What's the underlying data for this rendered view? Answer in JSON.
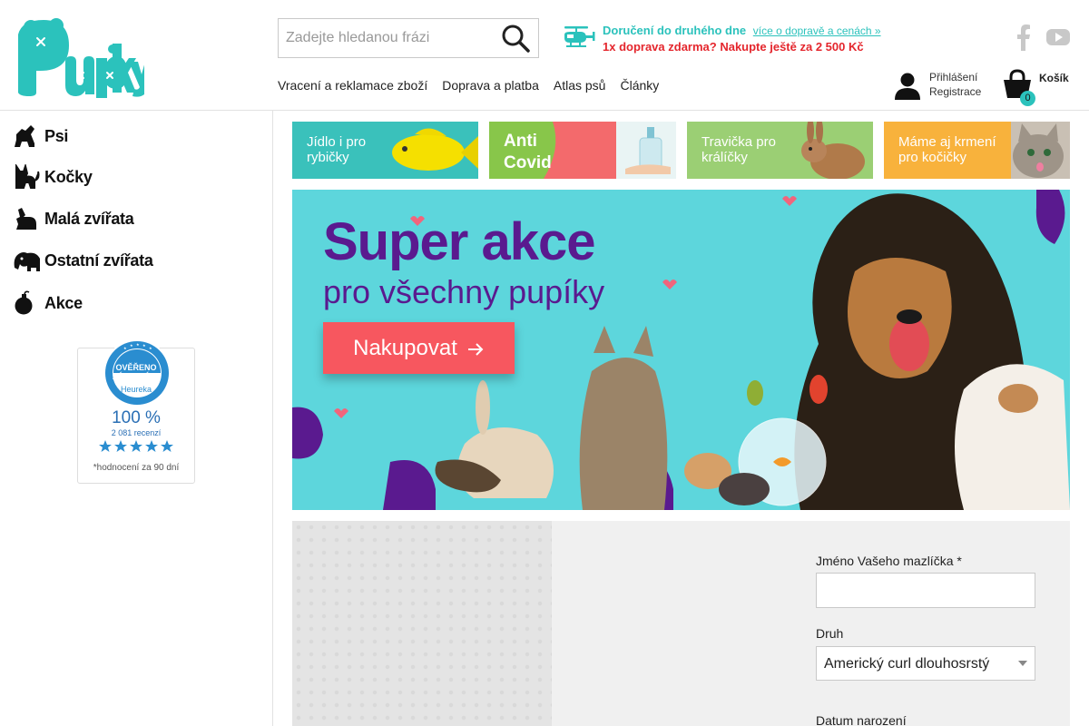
{
  "header": {
    "logo_alt": "Pupíky",
    "search": {
      "placeholder": "Zadejte hledanou frázi"
    },
    "delivery": {
      "line1_label": "Doručení do druhého dne",
      "line1_link": "více o dopravě a cenách »",
      "line2": "1x doprava zdarma? Nakupte ještě za 2 500 Kč"
    },
    "nav": [
      {
        "label": "Vracení a reklamace zboží"
      },
      {
        "label": "Doprava a platba"
      },
      {
        "label": "Atlas psů"
      },
      {
        "label": "Články"
      }
    ],
    "account": {
      "login": "Přihlášení",
      "register": "Registrace"
    },
    "cart": {
      "label": "Košík",
      "count": "0"
    }
  },
  "sidebar": {
    "categories": [
      {
        "label": "Psi",
        "icon": "dog-icon"
      },
      {
        "label": "Kočky",
        "icon": "cat-icon"
      },
      {
        "label": "Malá zvířata",
        "icon": "rabbit-icon"
      },
      {
        "label": "Ostatní zvířata",
        "icon": "elephant-icon"
      },
      {
        "label": "Akce",
        "icon": "bomb-icon"
      }
    ],
    "heureka": {
      "seal_line1": "OVĚŘENO",
      "seal_line2": "ZÁKAZNÍKY",
      "seal_brand": "Heureka",
      "percent": "100 %",
      "reviews": "2 081 recenzí",
      "note": "*hodnocení za 90 dní"
    }
  },
  "main": {
    "tiles": [
      {
        "line1": "Jídlo i pro",
        "line2": "rybičky",
        "color": "#3ac1bb"
      },
      {
        "line1": "Anti",
        "line2": "Covid",
        "color": "#f36a6c"
      },
      {
        "line1": "Travička pro",
        "line2": "králíčky",
        "color": "#9bcf74"
      },
      {
        "line1": "Máme aj krmení",
        "line2": "pro kočičky",
        "color": "#f8b23c"
      }
    ],
    "banner": {
      "title": "Super akce",
      "subtitle": "pro všechny pupíky",
      "button": "Nakupovat"
    },
    "form": {
      "pet_name_label": "Jméno Vašeho mazlíčka *",
      "pet_name_value": "",
      "breed_label": "Druh",
      "breed_value": "Americký curl dlouhosrstý",
      "birth_label": "Datum narození"
    }
  },
  "colors": {
    "brand_teal": "#2bc2bc",
    "alert_red": "#e4262d",
    "banner_bg": "#5dd6dc",
    "banner_purple": "#5a1a8f",
    "button_coral": "#f7575f"
  }
}
